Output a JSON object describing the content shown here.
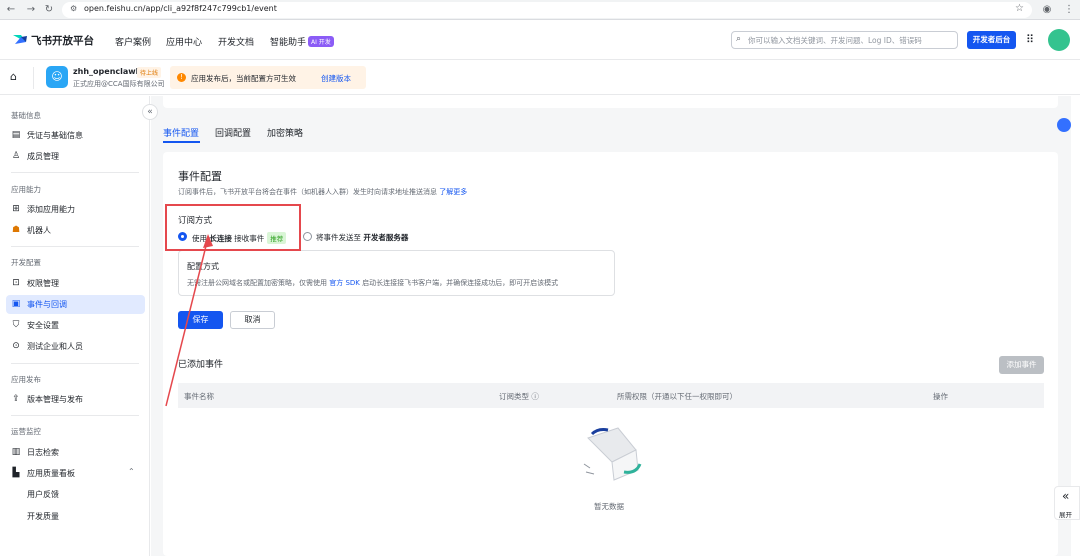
{
  "browser": {
    "url": "open.feishu.cn/app/cli_a92f8f247c799cb1/event"
  },
  "topnav": {
    "logo_text": "飞书开放平台",
    "links": [
      "客户案例",
      "应用中心",
      "开发文档",
      "智能助手"
    ],
    "ai_badge": "AI 开发",
    "search_placeholder": "你可以输入文档关键词、开发问题、Log ID、错误码",
    "dev_button": "开发者后台"
  },
  "app_header": {
    "app_name": "zhh_openclawbot",
    "status_badge": "待上线",
    "app_sub": "正式应用@CCA国际有限公司",
    "notice_text": "应用发布后，当前配置方可生效",
    "notice_link": "创建版本"
  },
  "sidebar": {
    "sections": [
      {
        "title": "基础信息",
        "items": [
          {
            "label": "凭证与基础信息",
            "icon": "credential-icon"
          },
          {
            "label": "成员管理",
            "icon": "member-icon"
          }
        ]
      },
      {
        "title": "应用能力",
        "items": [
          {
            "label": "添加应用能力",
            "icon": "grid-icon"
          },
          {
            "label": "机器人",
            "icon": "robot-icon"
          }
        ]
      },
      {
        "title": "开发配置",
        "items": [
          {
            "label": "权限管理",
            "icon": "lock-icon"
          },
          {
            "label": "事件与回调",
            "icon": "event-icon",
            "active": true
          },
          {
            "label": "安全设置",
            "icon": "shield-icon"
          },
          {
            "label": "测试企业和人员",
            "icon": "test-icon"
          }
        ]
      },
      {
        "title": "应用发布",
        "items": [
          {
            "label": "版本管理与发布",
            "icon": "upload-icon"
          }
        ]
      },
      {
        "title": "运营监控",
        "items": [
          {
            "label": "日志检索",
            "icon": "log-icon"
          },
          {
            "label": "应用质量看板",
            "icon": "chart-icon"
          },
          {
            "label": "用户反馈",
            "icon": ""
          },
          {
            "label": "开发质量",
            "icon": ""
          }
        ]
      }
    ]
  },
  "tabs": [
    "事件配置",
    "回调配置",
    "加密策略"
  ],
  "event_config": {
    "title": "事件配置",
    "desc": "订阅事件后，飞书开放平台将会在事件（如机器人入群）发生时向请求地址推送消息",
    "learn_more": "了解更多",
    "subscribe_label": "订阅方式",
    "option1_prefix": "使用",
    "option1_bold": "长连接",
    "option1_suffix": "接收事件",
    "option1_tag": "推荐",
    "option2_prefix": "将事件发送至",
    "option2_bold": "开发者服务器",
    "config_title": "配置方式",
    "config_desc_1": "无需注册公网域名或配置加密策略，仅需使用",
    "config_desc_link": "官方 SDK",
    "config_desc_2": "启动长连接接飞书客户端，并确保连接成功后，即可开启该模式",
    "save": "保存",
    "cancel": "取消"
  },
  "events": {
    "title": "已添加事件",
    "add_button": "添加事件",
    "columns": [
      "事件名称",
      "订阅类型",
      "所需权限（开通以下任一权限即可）",
      "操作"
    ],
    "empty_text": "暂无数据"
  },
  "expand_label": "展开"
}
